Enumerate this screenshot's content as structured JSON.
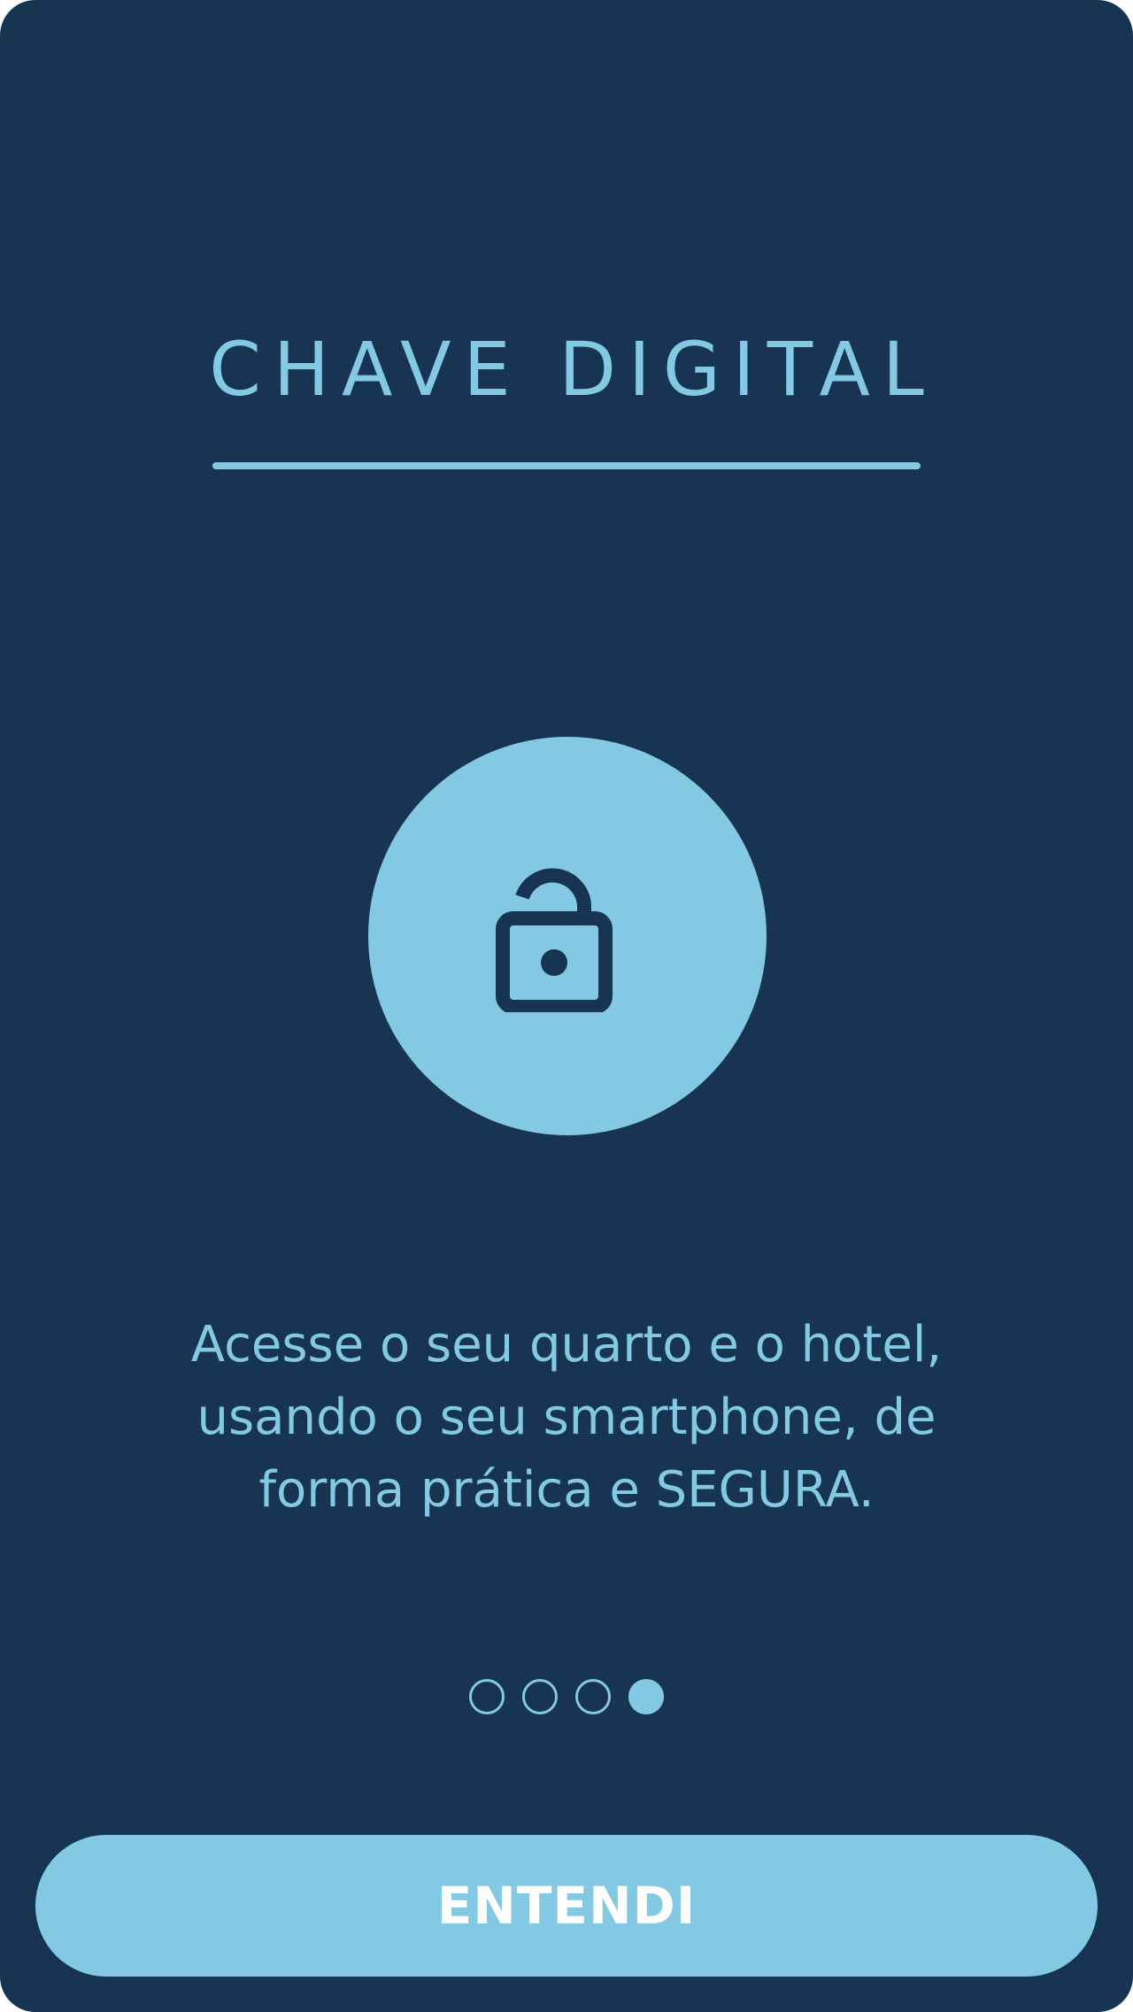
{
  "screen": {
    "title": "CHAVE DIGITAL",
    "icon": "lock-open-icon",
    "description": "Acesse o seu quarto e o hotel, usando o seu smartphone, de forma prática e SEGURA.",
    "button_label": "ENTENDI"
  },
  "pager": {
    "total": 4,
    "active_index": 4
  },
  "colors": {
    "background": "#173552",
    "accent": "#83c9e4",
    "button_text": "#ffffff"
  }
}
